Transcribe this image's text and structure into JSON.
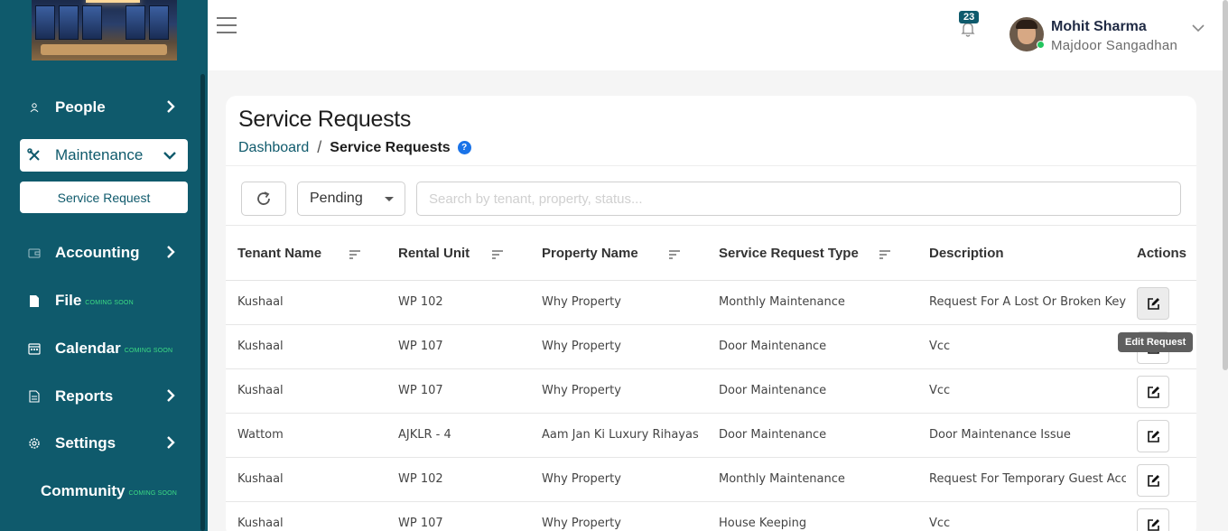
{
  "sidebar": {
    "items": [
      {
        "label": "People"
      },
      {
        "label": "Maintenance",
        "sub": "Service Request"
      },
      {
        "label": "Accounting"
      },
      {
        "label": "File",
        "badge": "COMING SOON"
      },
      {
        "label": "Calendar",
        "badge": "COMING SOON"
      },
      {
        "label": "Reports"
      },
      {
        "label": "Settings"
      },
      {
        "label": "Community",
        "badge": "COMING SOON"
      }
    ]
  },
  "header": {
    "notification_count": "23",
    "user_name": "Mohit Sharma",
    "user_org": "Majdoor Sangadhan"
  },
  "page": {
    "title": "Service Requests",
    "breadcrumb_link": "Dashboard",
    "breadcrumb_sep": "/",
    "breadcrumb_current": "Service Requests",
    "help": "?"
  },
  "toolbar": {
    "status_value": "Pending",
    "search_placeholder": "Search by tenant, property, status..."
  },
  "table": {
    "columns": [
      "Tenant Name",
      "Rental Unit",
      "Property Name",
      "Service Request Type",
      "Description",
      "Actions"
    ],
    "rows": [
      [
        "Kushaal",
        "WP 102",
        "Why Property",
        "Monthly Maintenance",
        "Request For A Lost Or Broken Key"
      ],
      [
        "Kushaal",
        "WP 107",
        "Why Property",
        "Door Maintenance",
        "Vcc"
      ],
      [
        "Kushaal",
        "WP 107",
        "Why Property",
        "Door Maintenance",
        "Vcc"
      ],
      [
        "Wattom",
        "AJKLR - 4",
        "Aam Jan Ki Luxury Rihayas",
        "Door Maintenance",
        "Door Maintenance Issue"
      ],
      [
        "Kushaal",
        "WP 102",
        "Why Property",
        "Monthly Maintenance",
        "Request For Temporary Guest Access"
      ],
      [
        "Kushaal",
        "WP 107",
        "Why Property",
        "House Keeping",
        "Vcc"
      ]
    ],
    "tooltip": "Edit Request"
  },
  "colors": {
    "sidebar_bg": "#0f5a6c",
    "accent": "#0f5a6c",
    "coming_soon": "#3ddc84"
  }
}
